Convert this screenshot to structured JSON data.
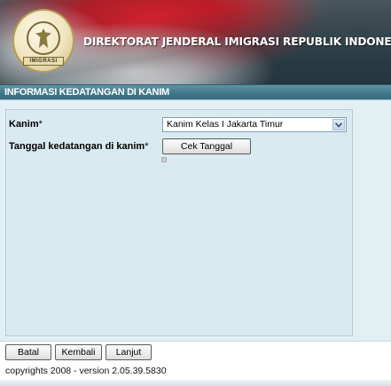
{
  "banner": {
    "title": "DIREKTORAT JENDERAL IMIGRASI REPUBLIK INDONESIA",
    "emblem_text": "IMIGRASI"
  },
  "section": {
    "title": "INFORMASI KEDATANGAN DI KANIM"
  },
  "form": {
    "kanim_label": "Kanim",
    "kanim_required": "*",
    "kanim_selected": "Kanim Kelas I Jakarta Timur",
    "tanggal_label": "Tanggal kedatangan di kanim",
    "tanggal_required": "*",
    "cek_tanggal_label": "Cek Tanggal"
  },
  "actions": {
    "batal_label": "Batal",
    "kembali_label": "Kembali",
    "lanjut_label": "Lanjut"
  },
  "footer": {
    "copyright": "copyrights 2008 - version 2.05.39.5830"
  },
  "colors": {
    "section_header": "#3f7688",
    "panel_background": "#d9ebf1",
    "content_background": "#e2eff3"
  }
}
